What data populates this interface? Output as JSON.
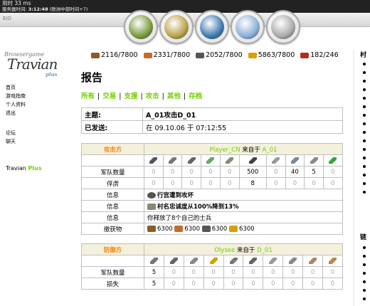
{
  "topbar": {
    "line1": "用时 33 ms",
    "line2_label": "服务器时间:",
    "line2_time": "3:12:48",
    "line2_note": "(欧洲中部时间+7)",
    "subbar_text": "EIO"
  },
  "nav_icons": [
    {
      "name": "village-overview-icon",
      "color": "#7a9a3a"
    },
    {
      "name": "village-center-icon",
      "color": "#b8a24a"
    },
    {
      "name": "map-icon",
      "color": "#3f7ab0"
    },
    {
      "name": "statistics-icon",
      "color": "#8ab0d8"
    },
    {
      "name": "reports-icon",
      "color": "#aaaaaa"
    }
  ],
  "logo": {
    "line1": "Browsergame",
    "line2": "Travian",
    "line3": "plus"
  },
  "left_menu": {
    "items1": [
      "首页",
      "游戏指南",
      "个人资料",
      "退出"
    ],
    "items2": [
      "论坛",
      "聊天"
    ],
    "plus_label": "Travian",
    "plus_suffix": "Plus"
  },
  "resources": [
    {
      "name": "lumber",
      "value": "2116/7800",
      "color": "#8b5a2b"
    },
    {
      "name": "clay",
      "value": "2331/7800",
      "color": "#c76b2a"
    },
    {
      "name": "iron",
      "value": "2052/7800",
      "color": "#555555"
    },
    {
      "name": "crop",
      "value": "5863/7800",
      "color": "#d8a000"
    },
    {
      "name": "crop-consumption",
      "value": "182/246",
      "color": "#b03020"
    }
  ],
  "page": {
    "title": "报告"
  },
  "tabs": [
    "所有",
    "交易",
    "支援",
    "攻击",
    "其他",
    "存档"
  ],
  "message": {
    "subject_label": "主题:",
    "subject": "A_01攻击D_01",
    "sent_label": "已发送:",
    "sent": "在 09.10.06 于 07:12:55"
  },
  "attacker": {
    "role": "攻击方",
    "player": "Player_CN",
    "from": "来自于",
    "village": "A_01",
    "units": [
      "#556",
      "#777",
      "#666",
      "#6a6",
      "#887",
      "#444",
      "#999",
      "#789",
      "#888",
      "#3a3"
    ],
    "rows": [
      {
        "label": "军队数量",
        "values": [
          "0",
          "0",
          "0",
          "0",
          "0",
          "500",
          "0",
          "40",
          "5",
          "0"
        ]
      },
      {
        "label": "俘虏",
        "values": [
          "0",
          "0",
          "0",
          "0",
          "0",
          "8",
          "0",
          "0",
          "0",
          "0"
        ]
      }
    ],
    "info1_label": "信息",
    "info1": "行宫遭到攻坏",
    "info2_label": "信息",
    "info2": "村名忠诚度从100%降到13%",
    "info3_label": "信息",
    "info3": "你释放了8个自己的士兵",
    "bounty_label": "缴获物",
    "bounty": [
      "6300",
      "6300",
      "6300",
      "6300"
    ]
  },
  "defender": {
    "role": "防御方",
    "player": "Olysee",
    "from": "来自于",
    "village": "D_01",
    "units": [
      "#777",
      "#666",
      "#888",
      "#d4a000",
      "#777",
      "#666",
      "#999",
      "#888",
      "#a86",
      "#b84"
    ],
    "rows": [
      {
        "label": "军队数量",
        "values": [
          "5",
          "0",
          "0",
          "0",
          "0",
          "0",
          "0",
          "0",
          "0",
          "0"
        ]
      },
      {
        "label": "损失",
        "values": [
          "5",
          "0",
          "0",
          "0",
          "0",
          "0",
          "0",
          "0",
          "0",
          "0"
        ]
      }
    ]
  },
  "right_col": {
    "head1": "村",
    "head2": "链"
  }
}
